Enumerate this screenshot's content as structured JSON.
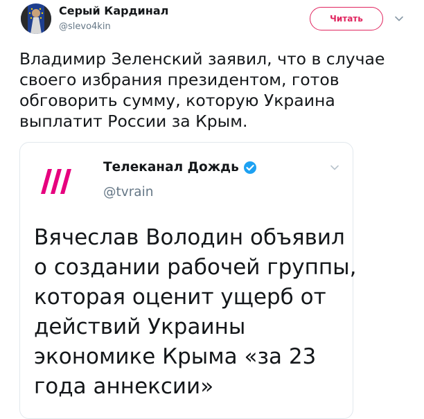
{
  "tweet": {
    "author": {
      "name": "Серый Кардинал",
      "handle": "@slevo4kin"
    },
    "follow_label": "Читать",
    "text_lines": [
      "Владимир Зеленский заявил, что в случае",
      "своего избрания президентом, готов",
      "обговорить сумму, которую Украина",
      "выплатит России за Крым."
    ]
  },
  "quoted": {
    "author": {
      "name": "Телеканал Дождь",
      "handle": "@tvrain",
      "verified": true
    },
    "text_lines": [
      "Вячеслав Володин объявил",
      "о создании рабочей группы,",
      "которая оценит ущерб от",
      "действий Украины",
      "экономике Крыма «за 23",
      "года аннексии»"
    ]
  },
  "colors": {
    "follow_accent": "#e0245e",
    "verified_badge": "#1da1f2",
    "logo": "#e6007e",
    "secondary_text": "#657786",
    "border": "#e1e8ed"
  },
  "icons": {
    "caret": "chevron-down-icon",
    "verified": "verified-badge-icon",
    "logo": "tvrain-logo-icon"
  }
}
